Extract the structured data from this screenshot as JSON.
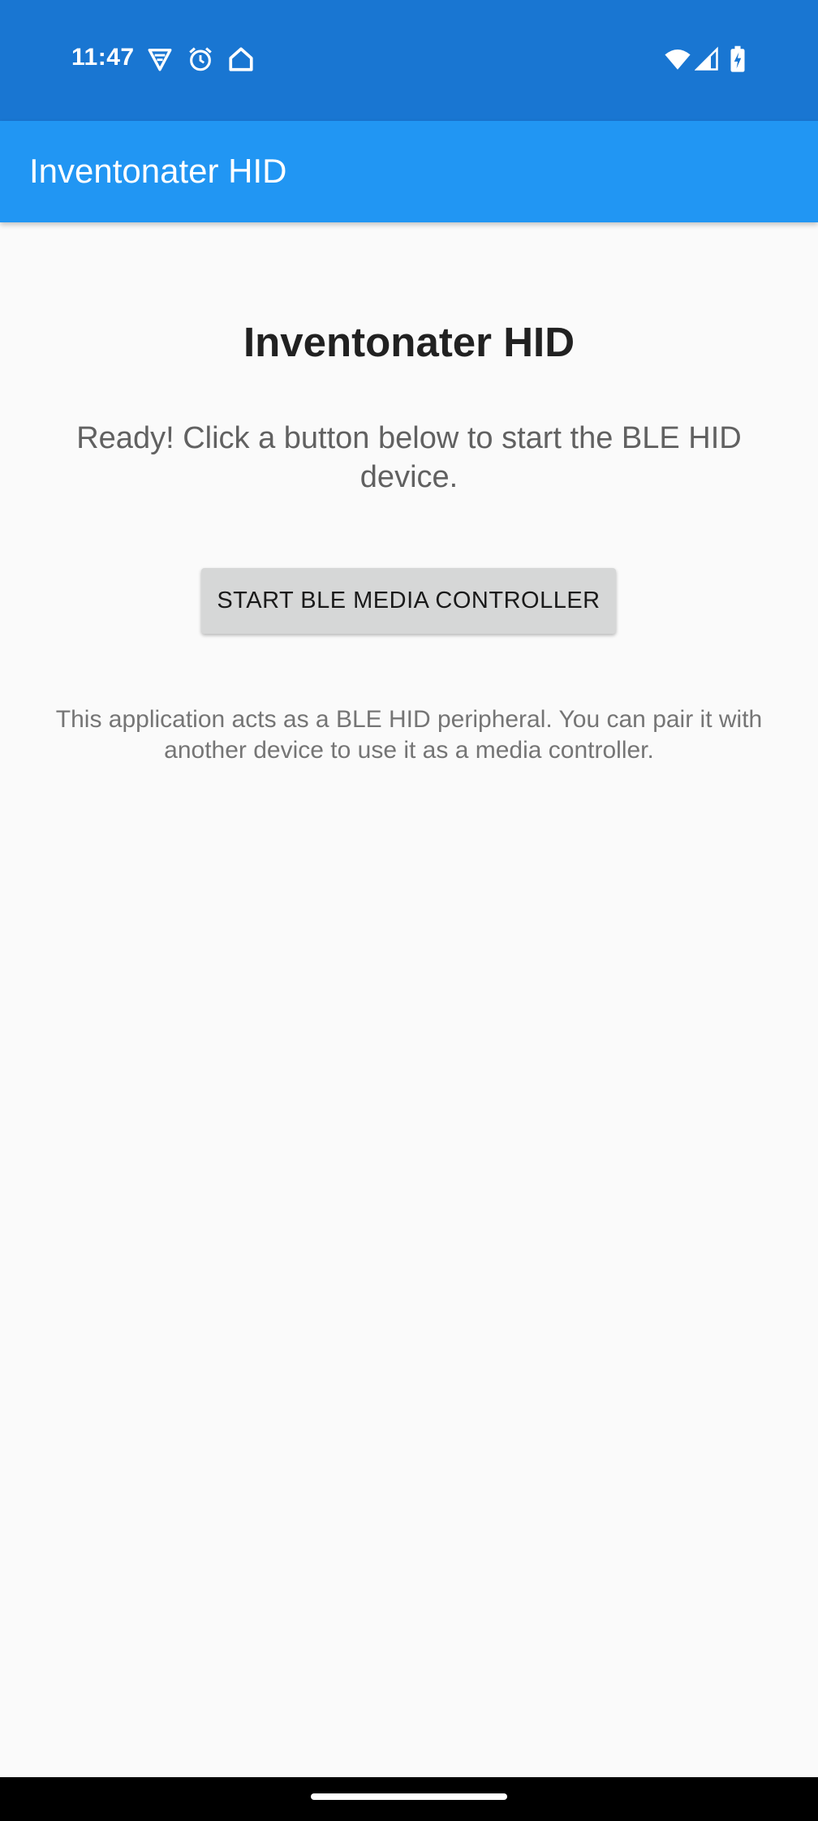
{
  "status_bar": {
    "time": "11:47",
    "background": "#1976d2",
    "icons_left": [
      "vpn-icon",
      "alarm-icon",
      "home-icon"
    ],
    "icons_right": [
      "wifi-icon",
      "signal-icon",
      "battery-charging-icon"
    ]
  },
  "app_bar": {
    "title": "Inventonater HID",
    "background": "#2196f3"
  },
  "main": {
    "heading": "Inventonater HID",
    "status_message": "Ready! Click a button below to start the BLE HID device.",
    "start_button_label": "START BLE MEDIA CONTROLLER",
    "info_text": "This application acts as a BLE HID peripheral. You can pair it with another device to use it as a media controller."
  },
  "nav_bar": {
    "background": "#000000"
  }
}
